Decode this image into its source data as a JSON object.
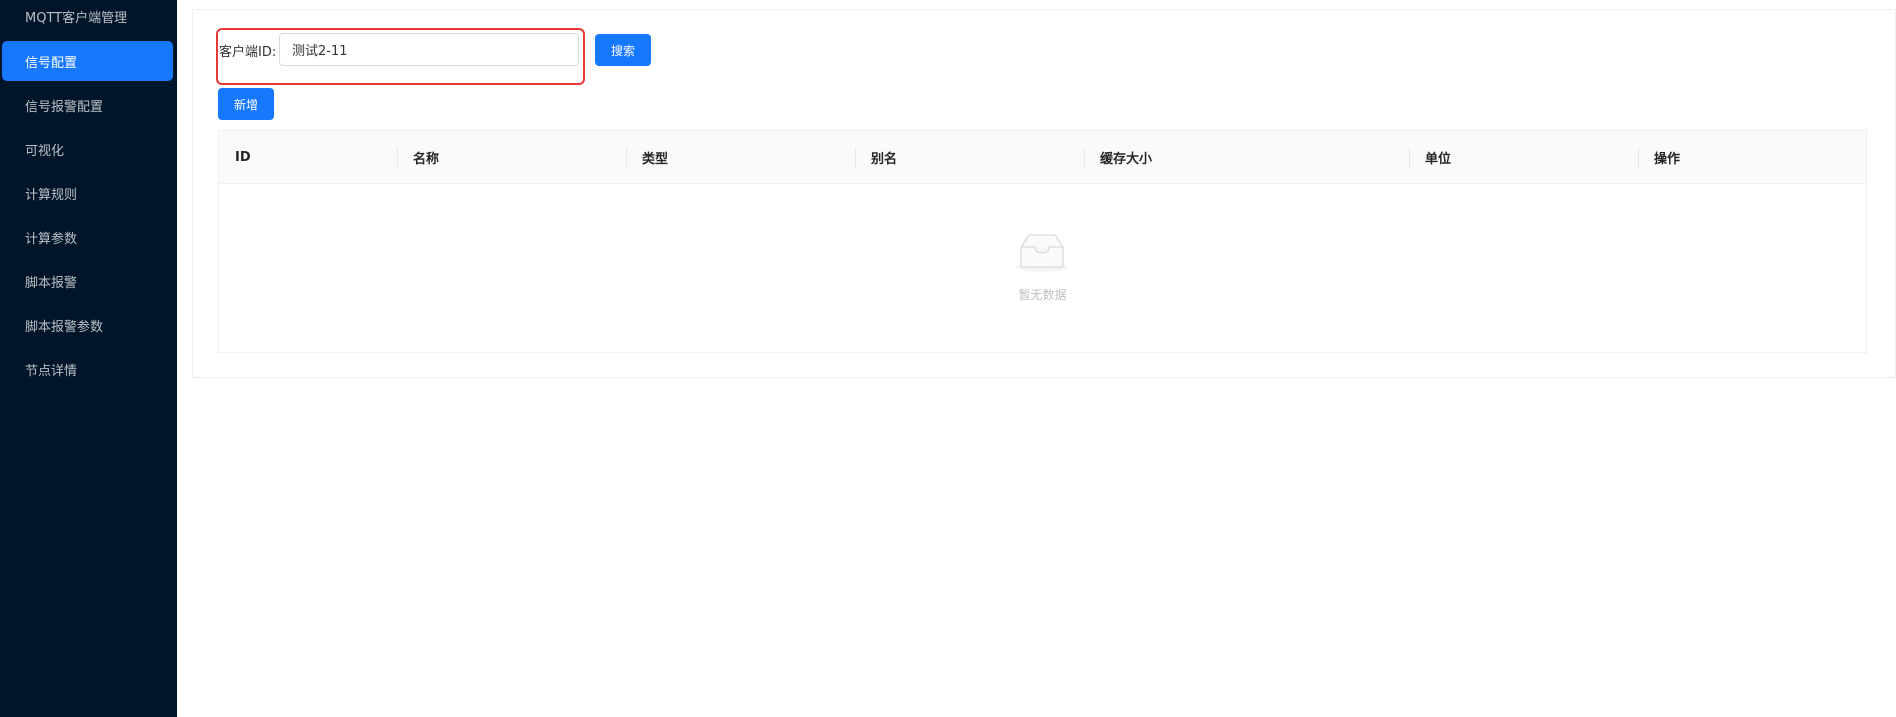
{
  "sidebar": {
    "items": [
      {
        "label": "MQTT客户端管理",
        "active": false
      },
      {
        "label": "信号配置",
        "active": true
      },
      {
        "label": "信号报警配置",
        "active": false
      },
      {
        "label": "可视化",
        "active": false
      },
      {
        "label": "计算规则",
        "active": false
      },
      {
        "label": "计算参数",
        "active": false
      },
      {
        "label": "脚本报警",
        "active": false
      },
      {
        "label": "脚本报警参数",
        "active": false
      },
      {
        "label": "节点详情",
        "active": false
      }
    ]
  },
  "search": {
    "label": "客户端ID:",
    "value": "测试2-11",
    "button_label": "搜索"
  },
  "toolbar": {
    "add_label": "新增"
  },
  "table": {
    "columns": [
      "ID",
      "名称",
      "类型",
      "别名",
      "缓存大小",
      "单位",
      "操作"
    ],
    "rows": [],
    "empty_text": "暂无数据"
  },
  "colors": {
    "sidebar_bg": "#001529",
    "primary": "#1677ff",
    "highlight": "#e53935"
  }
}
